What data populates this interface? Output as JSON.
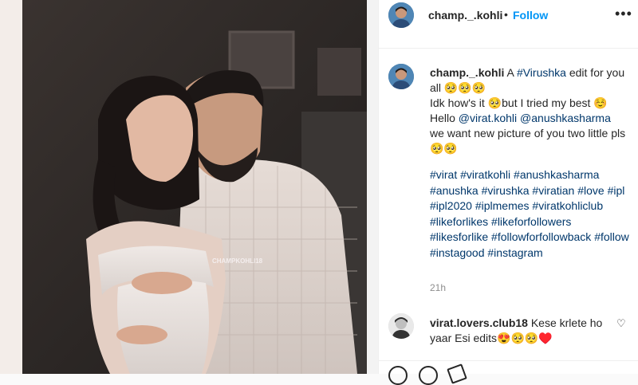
{
  "header": {
    "username": "champ._.kohli",
    "dot": "•",
    "follow_label": "Follow",
    "more_icon": "more-horizontal-icon"
  },
  "photo": {
    "watermark": "CHAMPKOHLI18"
  },
  "caption": {
    "username": "champ._.kohli",
    "line1_pre": " A ",
    "line1_tag": "#Virushka",
    "line1_post": " edit for you all 🥺🥺🥺",
    "line2": "Idk how's it 🥺but I tried my best ☺️",
    "line3_pre": "Hello ",
    "mention1": "@virat.kohli",
    "mention2": "@anushkasharma",
    "line4": "we want new picture of you two little pls 🥺🥺"
  },
  "hashtags": "#virat #viratkohli #anushkasharma #anushka #virushka #viratian #love #ipl #ipl2020 #iplmemes #viratkohliclub #likeforlikes #likeforfollowers #likesforlike #followforfollowback #follow #instagood #instagram",
  "timestamp": "21h",
  "comment": {
    "username": "virat.lovers.club18",
    "text": " Kese krlete ho yaar Esi edits😍🥺🥺♥️"
  },
  "colors": {
    "link": "#00376b",
    "follow": "#0095f6",
    "muted": "#8e8e8e"
  }
}
